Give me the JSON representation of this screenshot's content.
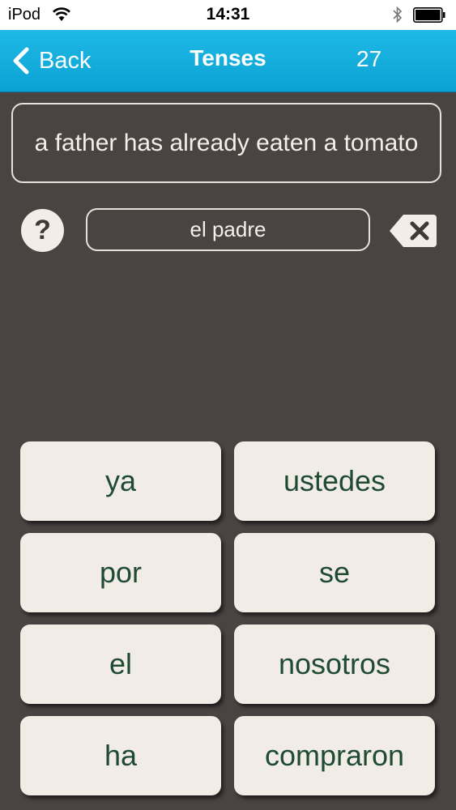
{
  "status_bar": {
    "carrier": "iPod",
    "time": "14:31"
  },
  "nav": {
    "back_label": "Back",
    "title": "Tenses",
    "count": "27"
  },
  "prompt": {
    "text": "a father has already eaten a tomato"
  },
  "help_label": "?",
  "answer": {
    "text": "el padre"
  },
  "words": [
    "ya",
    "ustedes",
    "por",
    "se",
    "el",
    "nosotros",
    "ha",
    "compraron"
  ],
  "colors": {
    "nav_bar": "#12ade0",
    "background": "#4a4342",
    "word_tile": "#f1ede6",
    "word_text": "#1f4a33"
  },
  "icons": [
    "wifi-icon",
    "bluetooth-icon",
    "battery-icon",
    "chevron-left-icon",
    "help-icon",
    "backspace-icon"
  ]
}
